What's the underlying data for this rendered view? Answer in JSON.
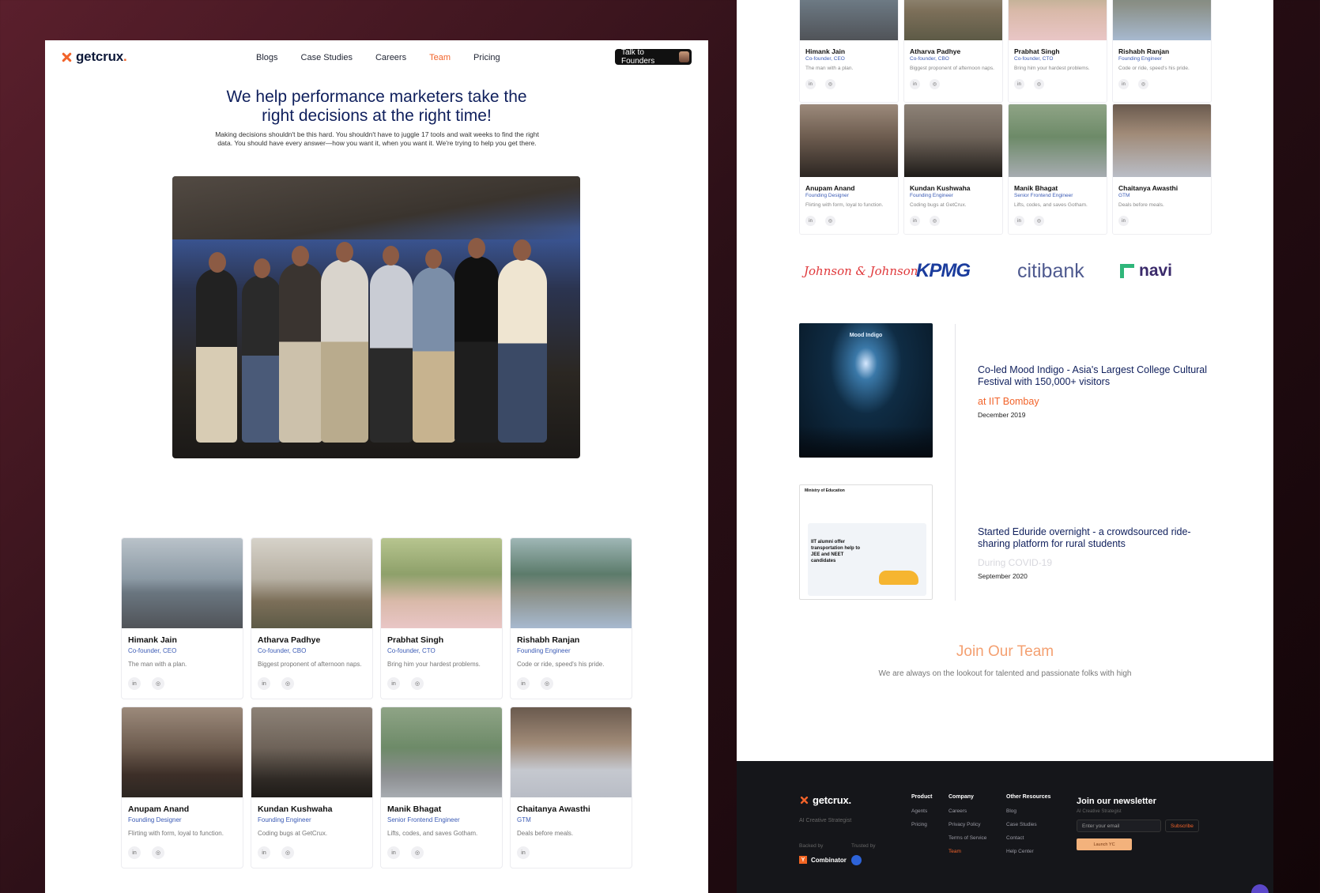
{
  "left": {
    "logo": {
      "name": "getcrux",
      "dot": "."
    },
    "nav": [
      "Blogs",
      "Case Studies",
      "Careers",
      "Team",
      "Pricing"
    ],
    "cta": "Talk to Founders",
    "hero_title_line1": "We help performance marketers take the",
    "hero_title_line2": "right decisions at the right time!",
    "hero_sub": "Making decisions shouldn't be this hard. You shouldn't have to juggle 17 tools and wait weeks to find the right data. You should have every answer—how you want it, when you want it. We're trying to help you get there.",
    "team": [
      {
        "name": "Himank Jain",
        "role": "Co-founder, CEO",
        "bio": "The man with a plan."
      },
      {
        "name": "Atharva Padhye",
        "role": "Co-founder, CBO",
        "bio": "Biggest proponent of afternoon naps."
      },
      {
        "name": "Prabhat Singh",
        "role": "Co-founder, CTO",
        "bio": "Bring him your hardest problems."
      },
      {
        "name": "Rishabh Ranjan",
        "role": "Founding Engineer",
        "bio": "Code or ride, speed's his pride."
      },
      {
        "name": "Anupam Anand",
        "role": "Founding Designer",
        "bio": "Flirting with form, loyal to function."
      },
      {
        "name": "Kundan Kushwaha",
        "role": "Founding Engineer",
        "bio": "Coding bugs at GetCrux."
      },
      {
        "name": "Manik Bhagat",
        "role": "Senior Frontend Engineer",
        "bio": "Lifts, codes, and saves Gotham."
      },
      {
        "name": "Chaitanya Awasthi",
        "role": "GTM",
        "bio": "Deals before meals."
      }
    ]
  },
  "right": {
    "brands": [
      "Johnson & Johnson",
      "KPMG",
      "citibank",
      "navi"
    ],
    "timeline": [
      {
        "title": "Co-led Mood Indigo - Asia's Largest College Cultural Festival with 150,000+ visitors",
        "sub": "at IIT Bombay",
        "date": "December 2019",
        "image_text": "Mood Indigo"
      },
      {
        "title": "Started Eduride overnight - a crowdsourced ride-sharing platform for rural students",
        "ghost": "During COVID-19",
        "date": "September 2020",
        "image_text": "IIT alumni offer transportation help to JEE and NEET candidates",
        "image_header": "Ministry of Education"
      }
    ],
    "join_title": "Join Our Team",
    "join_sub": "We are always on the lookout for talented and passionate folks with high",
    "footer": {
      "logo": "getcrux.",
      "tagline": "AI Creative Strategist",
      "backed_by": "Backed by",
      "trusted_by": "Trusted by",
      "yc": "Combinator",
      "cols": [
        {
          "h": "Product",
          "items": [
            "Agents",
            "Pricing"
          ]
        },
        {
          "h": "Company",
          "items": [
            "Careers",
            "Privacy Policy",
            "Terms of Service",
            "Team"
          ]
        },
        {
          "h": "Other Resources",
          "items": [
            "Blog",
            "Case Studies",
            "Contact",
            "Help Center"
          ]
        }
      ],
      "newsletter_title": "Join our newsletter",
      "newsletter_sub": "AI Creative Strategist",
      "email_placeholder": "Enter your email",
      "subscribe": "Subscribe",
      "ph_badge": "Launch YC"
    }
  }
}
